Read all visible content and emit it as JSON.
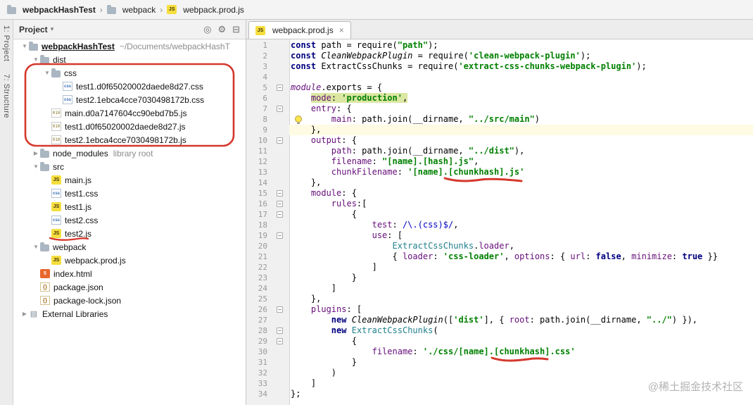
{
  "colors": {
    "annotation_red": "#D5382C",
    "keyword": "#000080",
    "string": "#008000",
    "property": "#660E7A",
    "teal_class": "#20808C",
    "regex": "#0000C0",
    "string_highlight": "#DCE7A3",
    "caret_line": "#FFFAE3"
  },
  "breadcrumb_bar": {
    "separator": "›",
    "items": [
      {
        "label": "webpackHashTest",
        "icon": "folder",
        "bold": true
      },
      {
        "label": "webpack",
        "icon": "folder",
        "bold": false
      },
      {
        "label": "webpack.prod.js",
        "icon": "js",
        "bold": false
      }
    ]
  },
  "tool_stripe": {
    "items": [
      "1: Project",
      "7: Structure"
    ]
  },
  "project_toolbar": {
    "title": "Project",
    "caret": "▾",
    "icons": [
      {
        "name": "locate-icon",
        "glyph": "◎"
      },
      {
        "name": "settings-icon",
        "glyph": "⚙"
      },
      {
        "name": "hide-panel-icon",
        "glyph": "⊟"
      }
    ]
  },
  "tree": {
    "rows": [
      {
        "label": "webpackHashTest",
        "meta": "~/Documents/webpackHashT",
        "icon": "folder",
        "indent": 0,
        "chevron": "down",
        "bold": true,
        "underline": true
      },
      {
        "label": "dist",
        "icon": "folder",
        "indent": 1,
        "chevron": "down"
      },
      {
        "label": "css",
        "icon": "folder",
        "indent": 2,
        "chevron": "down"
      },
      {
        "label": "test1.d0f65020002daede8d27.css",
        "icon": "css",
        "indent": 3,
        "chevron": "none"
      },
      {
        "label": "test2.1ebca4cce7030498172b.css",
        "icon": "css",
        "indent": 3,
        "chevron": "none"
      },
      {
        "label": "main.d0a7147604cc90ebd7b5.js",
        "icon": "jsdist",
        "indent": 2,
        "chevron": "none"
      },
      {
        "label": "test1.d0f65020002daede8d27.js",
        "icon": "jsdist",
        "indent": 2,
        "chevron": "none"
      },
      {
        "label": "test2.1ebca4cce7030498172b.js",
        "icon": "jsdist",
        "indent": 2,
        "chevron": "none"
      },
      {
        "label": "node_modules",
        "meta": "library root",
        "icon": "folder",
        "indent": 1,
        "chevron": "right"
      },
      {
        "label": "src",
        "icon": "folder",
        "indent": 1,
        "chevron": "down"
      },
      {
        "label": "main.js",
        "icon": "js",
        "indent": 2,
        "chevron": "none"
      },
      {
        "label": "test1.css",
        "icon": "css",
        "indent": 2,
        "chevron": "none"
      },
      {
        "label": "test1.js",
        "icon": "js",
        "indent": 2,
        "chevron": "none"
      },
      {
        "label": "test2.css",
        "icon": "css",
        "indent": 2,
        "chevron": "none"
      },
      {
        "label": "test2.js",
        "icon": "js",
        "indent": 2,
        "chevron": "none"
      },
      {
        "label": "webpack",
        "icon": "folder",
        "indent": 1,
        "chevron": "down"
      },
      {
        "label": "webpack.prod.js",
        "icon": "js",
        "indent": 2,
        "chevron": "none"
      },
      {
        "label": "index.html",
        "icon": "html",
        "indent": 1,
        "chevron": "none"
      },
      {
        "label": "package.json",
        "icon": "json",
        "indent": 1,
        "chevron": "none"
      },
      {
        "label": "package-lock.json",
        "icon": "json",
        "indent": 1,
        "chevron": "none"
      },
      {
        "label": "External Libraries",
        "icon": "extlib",
        "indent": 0,
        "chevron": "right"
      }
    ]
  },
  "editor": {
    "tab": {
      "label": "webpack.prod.js",
      "icon": "js",
      "close_label": "×"
    },
    "lines": [
      {
        "n": 1,
        "segs": [
          [
            "k",
            "const"
          ],
          [
            "c",
            " path = require("
          ],
          [
            "s",
            "\"path\""
          ],
          [
            "c",
            ");"
          ]
        ]
      },
      {
        "n": 2,
        "segs": [
          [
            "k",
            "const"
          ],
          [
            "c",
            " "
          ],
          [
            "i",
            "CleanWebpackPlugin"
          ],
          [
            "c",
            " = require("
          ],
          [
            "s",
            "'clean-webpack-plugin'"
          ],
          [
            "c",
            ");"
          ]
        ]
      },
      {
        "n": 3,
        "segs": [
          [
            "k",
            "const"
          ],
          [
            "c",
            " ExtractCssChunks = require("
          ],
          [
            "s",
            "'extract-css-chunks-webpack-plugin'"
          ],
          [
            "c",
            ");"
          ]
        ]
      },
      {
        "n": 4,
        "segs": []
      },
      {
        "n": 5,
        "fold": true,
        "segs": [
          [
            "g",
            "module"
          ],
          [
            "c",
            "."
          ],
          [
            "c",
            "exports = {"
          ]
        ]
      },
      {
        "n": 6,
        "segs": [
          [
            "c",
            "    "
          ],
          [
            "p hl",
            "mode"
          ],
          [
            "c hl",
            ": "
          ],
          [
            "s hl",
            "'production'"
          ],
          [
            "c hl",
            ","
          ]
        ]
      },
      {
        "n": 7,
        "fold": true,
        "segs": [
          [
            "c",
            "    "
          ],
          [
            "p",
            "entry"
          ],
          [
            "c",
            ": {"
          ]
        ]
      },
      {
        "n": 8,
        "bulb": true,
        "segs": [
          [
            "c",
            "        "
          ],
          [
            "p",
            "main"
          ],
          [
            "c",
            ": path.join(__dirname, "
          ],
          [
            "s",
            "\"../src/main\""
          ],
          [
            "c",
            ")"
          ]
        ]
      },
      {
        "n": 9,
        "caret": true,
        "segs": [
          [
            "c",
            "    },"
          ]
        ]
      },
      {
        "n": 10,
        "fold": true,
        "segs": [
          [
            "c",
            "    "
          ],
          [
            "p",
            "output"
          ],
          [
            "c",
            ": {"
          ]
        ]
      },
      {
        "n": 11,
        "segs": [
          [
            "c",
            "        "
          ],
          [
            "p",
            "path"
          ],
          [
            "c",
            ": path.join(__dirname, "
          ],
          [
            "s",
            "\"../dist\""
          ],
          [
            "c",
            "),"
          ]
        ]
      },
      {
        "n": 12,
        "segs": [
          [
            "c",
            "        "
          ],
          [
            "p",
            "filename"
          ],
          [
            "c",
            ": "
          ],
          [
            "s",
            "\"[name].[hash].js\""
          ],
          [
            "c",
            ","
          ]
        ]
      },
      {
        "n": 13,
        "segs": [
          [
            "c",
            "        "
          ],
          [
            "p",
            "chunkFilename"
          ],
          [
            "c",
            ": "
          ],
          [
            "s",
            "'[name].[chunkhash].js'"
          ]
        ]
      },
      {
        "n": 14,
        "segs": [
          [
            "c",
            "    },"
          ]
        ]
      },
      {
        "n": 15,
        "fold": true,
        "segs": [
          [
            "c",
            "    "
          ],
          [
            "p",
            "module"
          ],
          [
            "c",
            ": {"
          ]
        ]
      },
      {
        "n": 16,
        "fold": true,
        "segs": [
          [
            "c",
            "        "
          ],
          [
            "p",
            "rules"
          ],
          [
            "c",
            ":["
          ]
        ]
      },
      {
        "n": 17,
        "fold": true,
        "segs": [
          [
            "c",
            "            {"
          ]
        ]
      },
      {
        "n": 18,
        "segs": [
          [
            "c",
            "                "
          ],
          [
            "p",
            "test"
          ],
          [
            "c",
            ": "
          ],
          [
            "r",
            "/\\.(css)$/"
          ],
          [
            "c",
            ","
          ]
        ]
      },
      {
        "n": 19,
        "fold": true,
        "segs": [
          [
            "c",
            "                "
          ],
          [
            "p",
            "use"
          ],
          [
            "c",
            ": ["
          ]
        ]
      },
      {
        "n": 20,
        "segs": [
          [
            "c",
            "                    "
          ],
          [
            "t",
            "ExtractCssChunks"
          ],
          [
            "c",
            "."
          ],
          [
            "p",
            "loader"
          ],
          [
            "c",
            ","
          ]
        ]
      },
      {
        "n": 21,
        "segs": [
          [
            "c",
            "                    { "
          ],
          [
            "p",
            "loader"
          ],
          [
            "c",
            ": "
          ],
          [
            "s",
            "'css-loader'"
          ],
          [
            "c",
            ", "
          ],
          [
            "p",
            "options"
          ],
          [
            "c",
            ": { "
          ],
          [
            "p",
            "url"
          ],
          [
            "c",
            ": "
          ],
          [
            "k",
            "false"
          ],
          [
            "c",
            ", "
          ],
          [
            "p",
            "minimize"
          ],
          [
            "c",
            ": "
          ],
          [
            "k",
            "true"
          ],
          [
            "c",
            " }}"
          ]
        ]
      },
      {
        "n": 22,
        "segs": [
          [
            "c",
            "                ]"
          ]
        ]
      },
      {
        "n": 23,
        "segs": [
          [
            "c",
            "            }"
          ]
        ]
      },
      {
        "n": 24,
        "segs": [
          [
            "c",
            "        ]"
          ]
        ]
      },
      {
        "n": 25,
        "segs": [
          [
            "c",
            "    },"
          ]
        ]
      },
      {
        "n": 26,
        "fold": true,
        "segs": [
          [
            "c",
            "    "
          ],
          [
            "p",
            "plugins"
          ],
          [
            "c",
            ": ["
          ]
        ]
      },
      {
        "n": 27,
        "segs": [
          [
            "c",
            "        "
          ],
          [
            "k",
            "new"
          ],
          [
            "c",
            " "
          ],
          [
            "i",
            "CleanWebpackPlugin"
          ],
          [
            "c",
            "(["
          ],
          [
            "s",
            "'dist'"
          ],
          [
            "c",
            "], { "
          ],
          [
            "p",
            "root"
          ],
          [
            "c",
            ": path.join(__dirname, "
          ],
          [
            "s",
            "\"../\""
          ],
          [
            "c",
            ") }),"
          ]
        ]
      },
      {
        "n": 28,
        "fold": true,
        "segs": [
          [
            "c",
            "        "
          ],
          [
            "k",
            "new"
          ],
          [
            "c",
            " "
          ],
          [
            "t",
            "ExtractCssChunks"
          ],
          [
            "c",
            "("
          ]
        ]
      },
      {
        "n": 29,
        "fold": true,
        "segs": [
          [
            "c",
            "            {"
          ]
        ]
      },
      {
        "n": 30,
        "segs": [
          [
            "c",
            "                "
          ],
          [
            "p",
            "filename"
          ],
          [
            "c",
            ": "
          ],
          [
            "s",
            "'./css/[name].[chunkhash].css'"
          ]
        ]
      },
      {
        "n": 31,
        "segs": [
          [
            "c",
            "            }"
          ]
        ]
      },
      {
        "n": 32,
        "segs": [
          [
            "c",
            "        )"
          ]
        ]
      },
      {
        "n": 33,
        "segs": [
          [
            "c",
            "    ]"
          ]
        ]
      },
      {
        "n": 34,
        "segs": [
          [
            "c",
            "};"
          ]
        ]
      }
    ]
  },
  "watermark": "@稀土掘金技术社区"
}
